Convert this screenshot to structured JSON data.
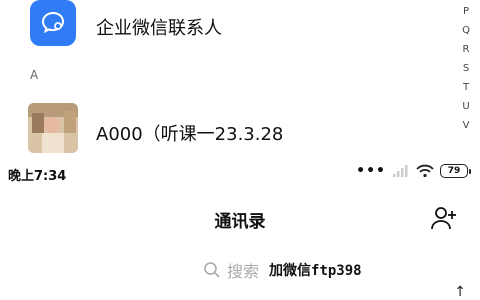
{
  "contacts_top": {
    "wecom_label": "企业微信联系人",
    "section_letter": "A",
    "contact_name": "A000（听课一23.3.28"
  },
  "alpha_index": [
    "P",
    "Q",
    "R",
    "S",
    "T",
    "U",
    "V"
  ],
  "status_bar": {
    "time": "晚上7:34",
    "battery": "79"
  },
  "nav": {
    "title": "通讯录"
  },
  "search": {
    "placeholder": "搜索",
    "overlay_text": "加微信ftp398"
  }
}
